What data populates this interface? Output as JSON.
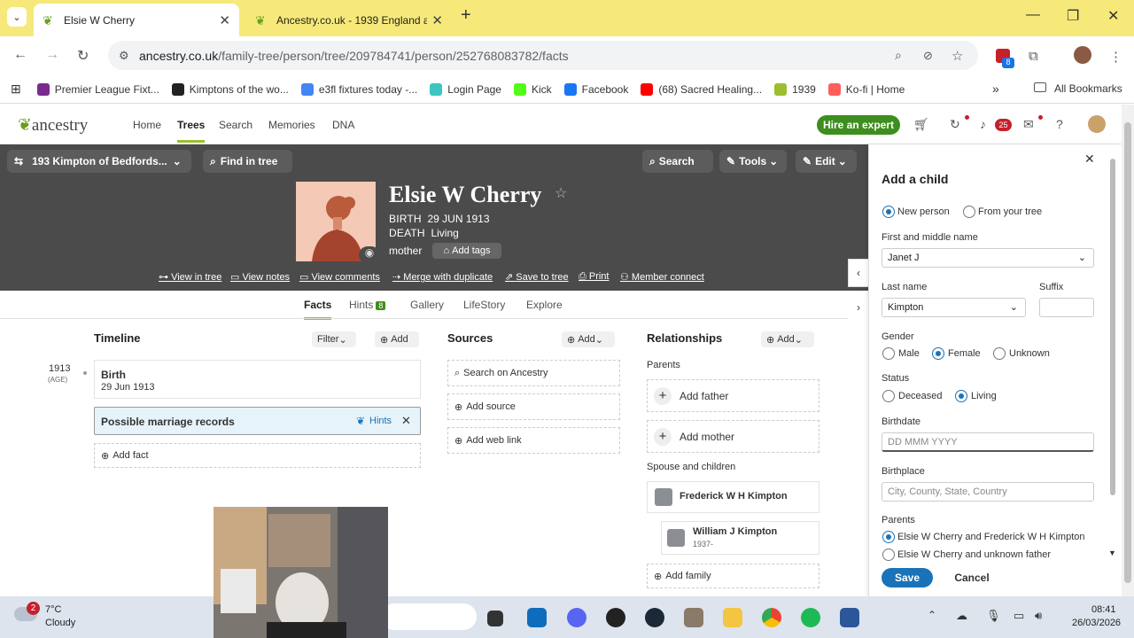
{
  "browser": {
    "tabs": [
      {
        "title": "Elsie W Cherry",
        "active": true
      },
      {
        "title": "Ancestry.co.uk - 1939 England a",
        "active": false
      }
    ],
    "url_host": "ancestry.co.uk",
    "url_path": "/family-tree/person/tree/209784741/person/252768083782/facts",
    "extension_badge": "8"
  },
  "bookmarks": [
    {
      "label": "Premier League Fixt...",
      "color": "#7b2b8f"
    },
    {
      "label": "Kimptons of the wo...",
      "color": "#222222"
    },
    {
      "label": "e3fl fixtures today -...",
      "color": "#4285f4"
    },
    {
      "label": "Login Page",
      "color": "#3cc6c0"
    },
    {
      "label": "Kick",
      "color": "#53fc18"
    },
    {
      "label": "Facebook",
      "color": "#1877f2"
    },
    {
      "label": "(68) Sacred Healing...",
      "color": "#ff0000"
    },
    {
      "label": "1939",
      "color": "#9cbe30"
    },
    {
      "label": "Ko-fi | Home",
      "color": "#ff5e5b"
    }
  ],
  "bookmarks_more": "»",
  "all_bookmarks": "All Bookmarks",
  "ancestry": {
    "logo": "ancestry",
    "nav": [
      "Home",
      "Trees",
      "Search",
      "Memories",
      "DNA"
    ],
    "hire": "Hire an expert",
    "notif_count": "25"
  },
  "tree_bar": {
    "tree_name": "193 Kimpton of Bedfords...",
    "find": "Find in tree",
    "search": "Search",
    "tools": "Tools",
    "edit": "Edit"
  },
  "person": {
    "name": "Elsie W Cherry",
    "birth_label": "BIRTH",
    "birth_value": "29 JUN 1913",
    "death_label": "DEATH",
    "death_value": "Living",
    "role": "mother",
    "add_tags": "Add tags"
  },
  "actions": [
    "View in tree",
    "View notes",
    "View comments",
    "Merge with duplicate",
    "Save to tree",
    "Print",
    "Member connect"
  ],
  "subtabs": {
    "facts": "Facts",
    "hints": "Hints",
    "hints_count": "8",
    "gallery": "Gallery",
    "lifestory": "LifeStory",
    "explore": "Explore"
  },
  "timeline": {
    "title": "Timeline",
    "filter": "Filter",
    "add": "Add",
    "year": "1913",
    "age": "(AGE)",
    "event_title": "Birth",
    "event_date": "29 Jun 1913",
    "hint_text": "Possible marriage records",
    "hint_link": "Hints",
    "add_fact": "Add fact"
  },
  "sources": {
    "title": "Sources",
    "add": "Add",
    "search": "Search on Ancestry",
    "add_source": "Add source",
    "add_web_link": "Add web link"
  },
  "relationships": {
    "title": "Relationships",
    "add": "Add",
    "parents_label": "Parents",
    "add_father": "Add father",
    "add_mother": "Add mother",
    "spouse_label": "Spouse and children",
    "spouse": "Frederick W H Kimpton",
    "child_name": "William J Kimpton",
    "child_years": "1937-",
    "add_family": "Add family"
  },
  "panel": {
    "title": "Add a child",
    "opt_new": "New person",
    "opt_tree": "From your tree",
    "first_label": "First and middle name",
    "first_value": "Janet J",
    "last_label": "Last name",
    "last_value": "Kimpton",
    "suffix_label": "Suffix",
    "suffix_value": "",
    "gender_label": "Gender",
    "male": "Male",
    "female": "Female",
    "unknown": "Unknown",
    "status_label": "Status",
    "deceased": "Deceased",
    "living": "Living",
    "birthdate_label": "Birthdate",
    "birthdate_placeholder": "DD MMM YYYY",
    "birthplace_label": "Birthplace",
    "birthplace_placeholder": "City, County, State, Country",
    "parents_label": "Parents",
    "parents_opt1": "Elsie W Cherry and Frederick W H Kimpton",
    "parents_opt2": "Elsie W Cherry and unknown father",
    "save": "Save",
    "cancel": "Cancel"
  },
  "taskbar": {
    "weather_temp": "7°C",
    "weather_desc": "Cloudy",
    "weather_badge": "2",
    "time": "08:41",
    "date": "26/03/2026"
  }
}
